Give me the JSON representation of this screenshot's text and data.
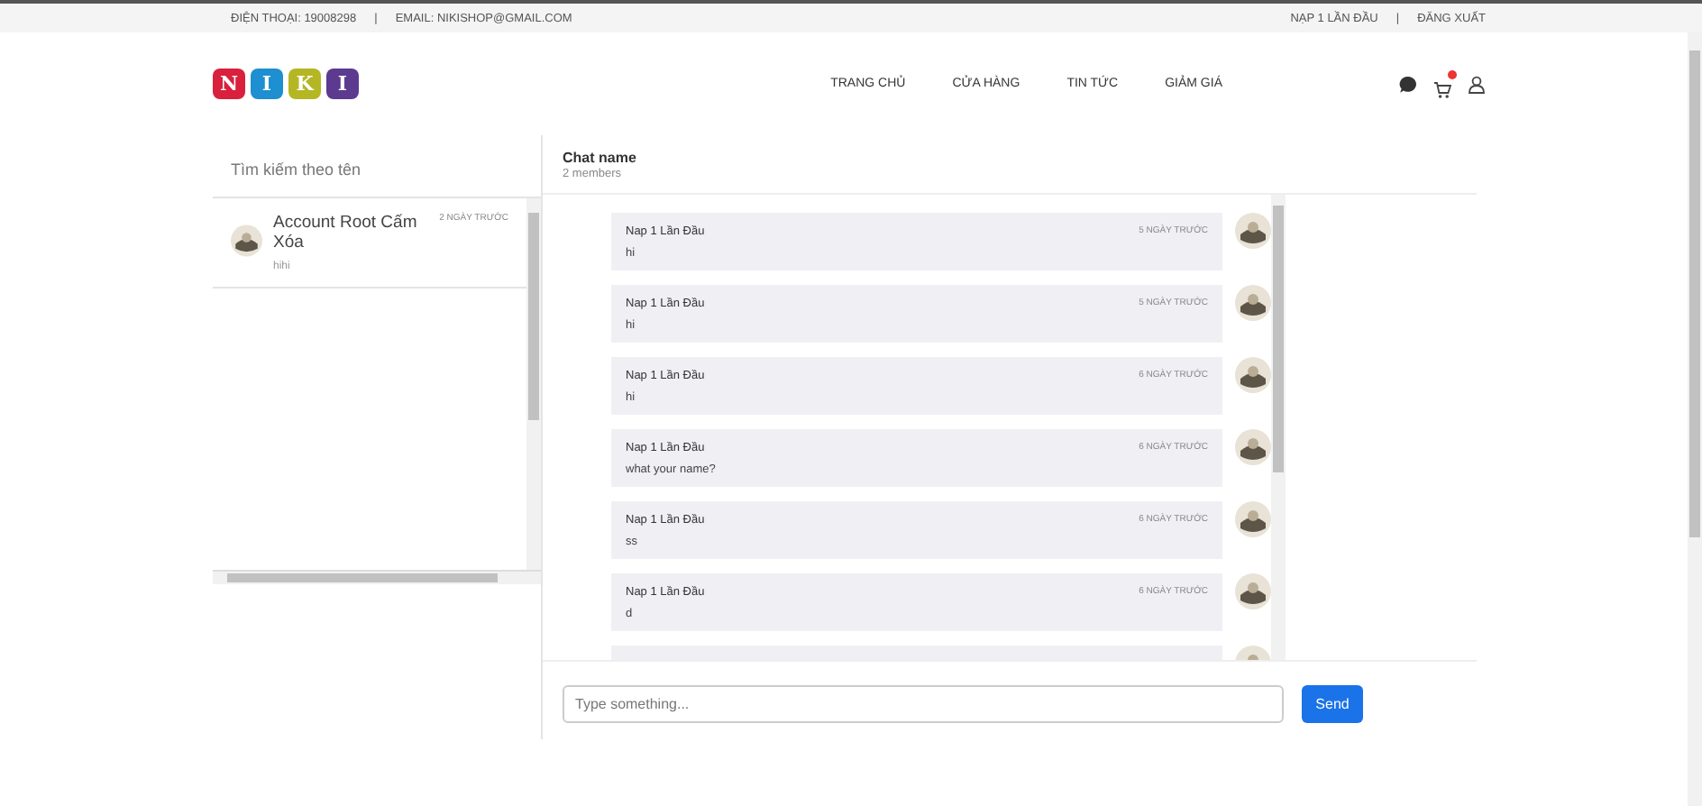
{
  "topbar": {
    "phone": "ĐIỆN THOẠI: 19008298",
    "separator": "|",
    "email": "EMAIL: NIKISHOP@GMAIL.COM",
    "user": "NẠP 1 LẦN ĐẦU",
    "separator_2": "|",
    "logout": "ĐĂNG XUẤT"
  },
  "logo": [
    {
      "letter": "N",
      "color": "#d9203c"
    },
    {
      "letter": "I",
      "color": "#1e8fd0"
    },
    {
      "letter": "K",
      "color": "#b5b624"
    },
    {
      "letter": "I",
      "color": "#5b3a8f"
    }
  ],
  "nav": [
    "TRANG CHỦ",
    "CỬA HÀNG",
    "TIN TỨC",
    "GIẢM GIÁ"
  ],
  "cart": {
    "has_badge": true
  },
  "sidebar": {
    "search": {
      "placeholder": "Tìm kiếm theo tên"
    },
    "conversations": [
      {
        "name": "Account Root Cấm Xóa",
        "time": "2 NGÀY TRƯỚC",
        "preview": "hihi"
      }
    ]
  },
  "chat": {
    "title": "Chat name",
    "subtitle": "2 members",
    "messages": [
      {
        "sender": "Nap 1 Lần Đầu",
        "time": "5 NGÀY TRƯỚC",
        "text": "hi"
      },
      {
        "sender": "Nap 1 Lần Đầu",
        "time": "5 NGÀY TRƯỚC",
        "text": "hi"
      },
      {
        "sender": "Nap 1 Lần Đầu",
        "time": "6 NGÀY TRƯỚC",
        "text": "hi"
      },
      {
        "sender": "Nap 1 Lần Đầu",
        "time": "6 NGÀY TRƯỚC",
        "text": "what your name?"
      },
      {
        "sender": "Nap 1 Lần Đầu",
        "time": "6 NGÀY TRƯỚC",
        "text": "ss"
      },
      {
        "sender": "Nap 1 Lần Đầu",
        "time": "6 NGÀY TRƯỚC",
        "text": "d"
      }
    ],
    "input": {
      "placeholder": "Type something..."
    },
    "send": "Send"
  }
}
